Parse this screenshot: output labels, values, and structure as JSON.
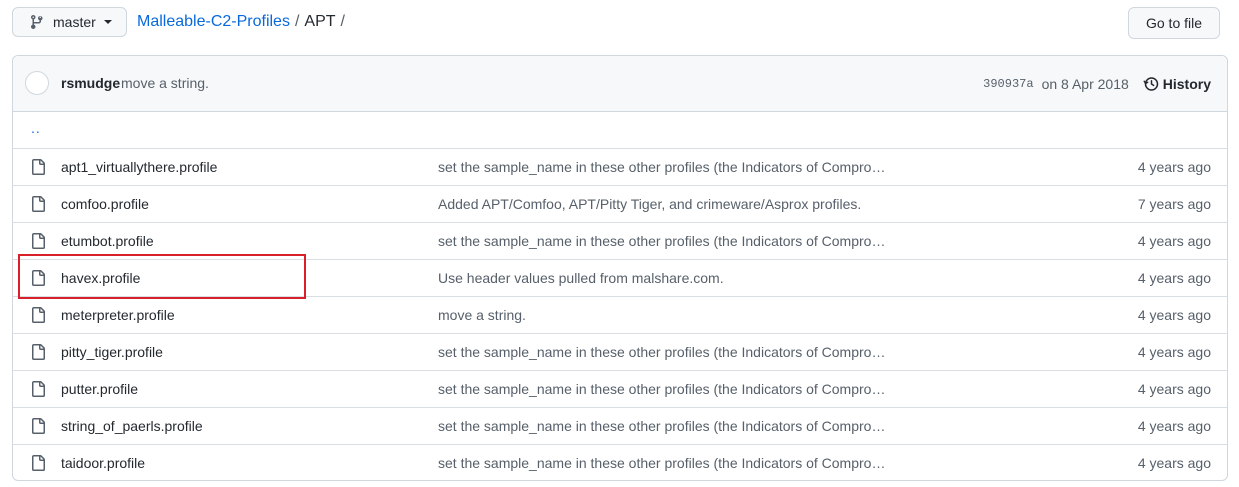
{
  "branch": {
    "label": "master",
    "icon": "branch-icon"
  },
  "breadcrumb": {
    "repo": "Malleable-C2-Profiles",
    "sep1": "/",
    "folder": "APT",
    "sep2": "/"
  },
  "goto_file": {
    "label": "Go to file"
  },
  "latest_commit": {
    "author": "rsmudge",
    "message": "move a string.",
    "sha": "390937a",
    "date": "on 8 Apr 2018",
    "history_label": "History"
  },
  "updir": {
    "label": ".."
  },
  "files": [
    {
      "name": "apt1_virtuallythere.profile",
      "message": "set the sample_name in these other profiles (the Indicators of Compro…",
      "age": "4 years ago"
    },
    {
      "name": "comfoo.profile",
      "message": "Added APT/Comfoo, APT/Pitty Tiger, and crimeware/Asprox profiles.",
      "age": "7 years ago"
    },
    {
      "name": "etumbot.profile",
      "message": "set the sample_name in these other profiles (the Indicators of Compro…",
      "age": "4 years ago"
    },
    {
      "name": "havex.profile",
      "message": "Use header values pulled from malshare.com.",
      "age": "4 years ago"
    },
    {
      "name": "meterpreter.profile",
      "message": "move a string.",
      "age": "4 years ago"
    },
    {
      "name": "pitty_tiger.profile",
      "message": "set the sample_name in these other profiles (the Indicators of Compro…",
      "age": "4 years ago"
    },
    {
      "name": "putter.profile",
      "message": "set the sample_name in these other profiles (the Indicators of Compro…",
      "age": "4 years ago"
    },
    {
      "name": "string_of_paerls.profile",
      "message": "set the sample_name in these other profiles (the Indicators of Compro…",
      "age": "4 years ago"
    },
    {
      "name": "taidoor.profile",
      "message": "set the sample_name in these other profiles (the Indicators of Compro…",
      "age": "4 years ago"
    }
  ],
  "colors": {
    "link": "#0969da",
    "highlight": "#d9202a",
    "muted": "#57606a"
  }
}
